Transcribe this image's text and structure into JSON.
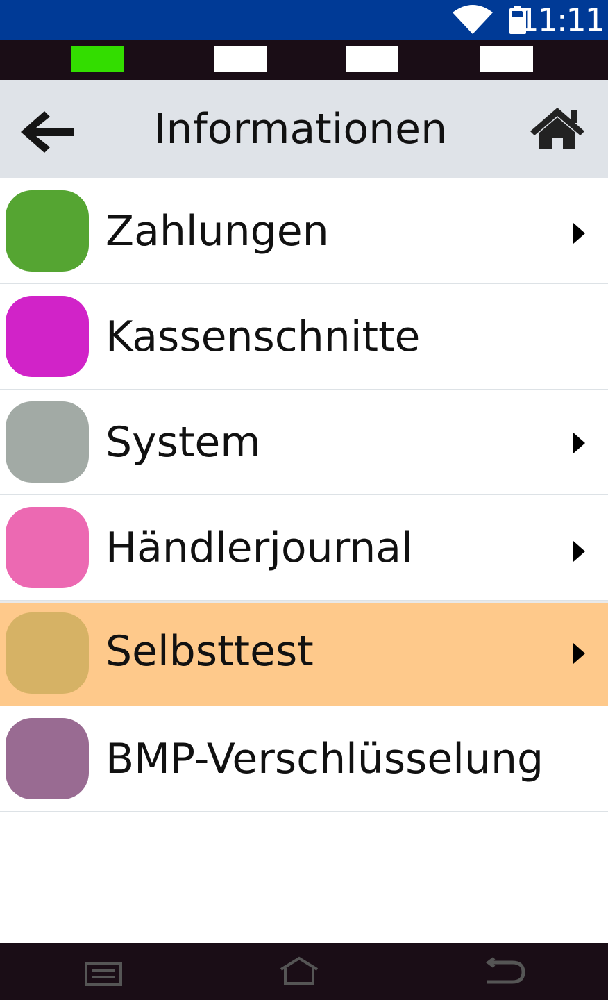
{
  "status_bar": {
    "time": "11:11",
    "icons": [
      "wifi-icon",
      "battery-icon"
    ],
    "background": "#003a96"
  },
  "led_strip": {
    "leds": [
      {
        "color": "#33dd00"
      },
      {
        "color": "#ffffff"
      },
      {
        "color": "#ffffff"
      },
      {
        "color": "#ffffff"
      }
    ]
  },
  "header": {
    "title": "Informationen",
    "back_icon": "arrow-left-icon",
    "home_icon": "home-icon"
  },
  "menu": {
    "items": [
      {
        "label": "Zahlungen",
        "color": "#55a532",
        "has_submenu": true,
        "selected": false
      },
      {
        "label": "Kassenschnitte",
        "color": "#d123c8",
        "has_submenu": false,
        "selected": false
      },
      {
        "label": "System",
        "color": "#a2aaa5",
        "has_submenu": true,
        "selected": false
      },
      {
        "label": "Händlerjournal",
        "color": "#ec69b2",
        "has_submenu": true,
        "selected": false
      },
      {
        "label": "Selbsttest",
        "color": "#d6b265",
        "has_submenu": true,
        "selected": true
      },
      {
        "label": "BMP-Verschlüsselung",
        "color": "#996b92",
        "has_submenu": false,
        "selected": false
      }
    ]
  },
  "nav_bar": {
    "buttons": [
      "recent-apps-icon",
      "home-icon",
      "back-icon"
    ]
  }
}
